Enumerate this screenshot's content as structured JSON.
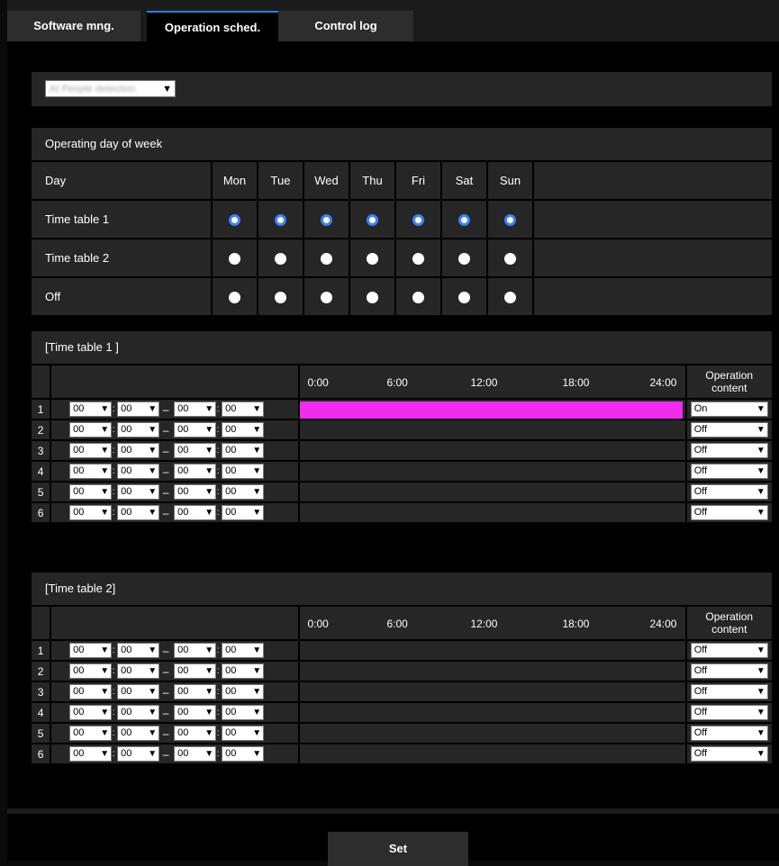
{
  "tabs": [
    {
      "label": "Software mng.",
      "active": false
    },
    {
      "label": "Operation sched.",
      "active": true
    },
    {
      "label": "Control log",
      "active": false
    }
  ],
  "schedule_select": {
    "value": "AI People detection"
  },
  "operating_days": {
    "title": "Operating day of week",
    "day_label": "Day",
    "days": [
      "Mon",
      "Tue",
      "Wed",
      "Thu",
      "Fri",
      "Sat",
      "Sun"
    ],
    "rows": [
      {
        "label": "Time table 1",
        "selected": [
          true,
          true,
          true,
          true,
          true,
          true,
          true
        ]
      },
      {
        "label": "Time table 2",
        "selected": [
          false,
          false,
          false,
          false,
          false,
          false,
          false
        ]
      },
      {
        "label": "Off",
        "selected": [
          false,
          false,
          false,
          false,
          false,
          false,
          false
        ]
      }
    ]
  },
  "timetable1": {
    "title": "[Time table 1 ]",
    "scale": [
      "0:00",
      "6:00",
      "12:00",
      "18:00",
      "24:00"
    ],
    "op_header": [
      "Operation",
      "content"
    ],
    "rows": [
      {
        "num": "1",
        "start_h": "00",
        "start_m": "00",
        "end_h": "00",
        "end_m": "00",
        "op": "On",
        "fill": 1.0
      },
      {
        "num": "2",
        "start_h": "00",
        "start_m": "00",
        "end_h": "00",
        "end_m": "00",
        "op": "Off",
        "fill": 0
      },
      {
        "num": "3",
        "start_h": "00",
        "start_m": "00",
        "end_h": "00",
        "end_m": "00",
        "op": "Off",
        "fill": 0
      },
      {
        "num": "4",
        "start_h": "00",
        "start_m": "00",
        "end_h": "00",
        "end_m": "00",
        "op": "Off",
        "fill": 0
      },
      {
        "num": "5",
        "start_h": "00",
        "start_m": "00",
        "end_h": "00",
        "end_m": "00",
        "op": "Off",
        "fill": 0
      },
      {
        "num": "6",
        "start_h": "00",
        "start_m": "00",
        "end_h": "00",
        "end_m": "00",
        "op": "Off",
        "fill": 0
      }
    ]
  },
  "timetable2": {
    "title": "[Time table 2]",
    "scale": [
      "0:00",
      "6:00",
      "12:00",
      "18:00",
      "24:00"
    ],
    "op_header": [
      "Operation",
      "content"
    ],
    "rows": [
      {
        "num": "1",
        "start_h": "00",
        "start_m": "00",
        "end_h": "00",
        "end_m": "00",
        "op": "Off",
        "fill": 0
      },
      {
        "num": "2",
        "start_h": "00",
        "start_m": "00",
        "end_h": "00",
        "end_m": "00",
        "op": "Off",
        "fill": 0
      },
      {
        "num": "3",
        "start_h": "00",
        "start_m": "00",
        "end_h": "00",
        "end_m": "00",
        "op": "Off",
        "fill": 0
      },
      {
        "num": "4",
        "start_h": "00",
        "start_m": "00",
        "end_h": "00",
        "end_m": "00",
        "op": "Off",
        "fill": 0
      },
      {
        "num": "5",
        "start_h": "00",
        "start_m": "00",
        "end_h": "00",
        "end_m": "00",
        "op": "Off",
        "fill": 0
      },
      {
        "num": "6",
        "start_h": "00",
        "start_m": "00",
        "end_h": "00",
        "end_m": "00",
        "op": "Off",
        "fill": 0
      }
    ]
  },
  "set_button": {
    "label": "Set"
  },
  "colors": {
    "accent": "#2f7fd8",
    "radio_selected": "#3b82f6",
    "schedule_fill": "#ef2cef"
  }
}
